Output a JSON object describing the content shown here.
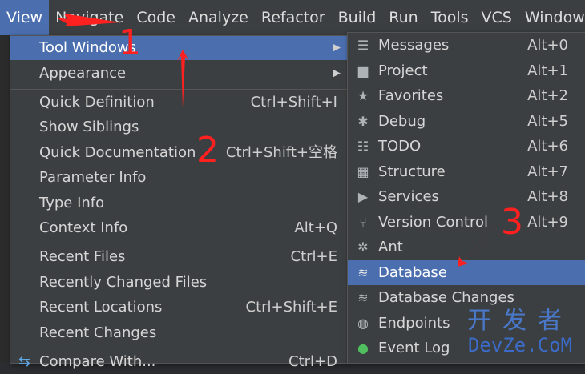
{
  "menubar": {
    "items": [
      "View",
      "Navigate",
      "Code",
      "Analyze",
      "Refactor",
      "Build",
      "Run",
      "Tools",
      "VCS",
      "Window"
    ]
  },
  "view_menu": {
    "items": [
      {
        "label": "Tool Windows",
        "shortcut": "",
        "submenu": true,
        "selected": true
      },
      {
        "label": "Appearance",
        "shortcut": "",
        "submenu": true
      },
      {
        "label": "Quick Definition",
        "shortcut": "Ctrl+Shift+I"
      },
      {
        "label": "Show Siblings",
        "shortcut": ""
      },
      {
        "label": "Quick Documentation",
        "shortcut": "Ctrl+Shift+空格"
      },
      {
        "label": "Parameter Info",
        "shortcut": ""
      },
      {
        "label": "Type Info",
        "shortcut": ""
      },
      {
        "label": "Context Info",
        "shortcut": "Alt+Q"
      },
      {
        "label": "Recent Files",
        "shortcut": "Ctrl+E"
      },
      {
        "label": "Recently Changed Files",
        "shortcut": ""
      },
      {
        "label": "Recent Locations",
        "shortcut": "Ctrl+Shift+E"
      },
      {
        "label": "Recent Changes",
        "shortcut": ""
      },
      {
        "label": "Compare With...",
        "shortcut": "Ctrl+D"
      }
    ]
  },
  "tool_windows": {
    "items": [
      {
        "label": "Messages",
        "shortcut": "Alt+0",
        "icon": "messages-icon"
      },
      {
        "label": "Project",
        "shortcut": "Alt+1",
        "icon": "folder-icon"
      },
      {
        "label": "Favorites",
        "shortcut": "Alt+2",
        "icon": "star-icon"
      },
      {
        "label": "Debug",
        "shortcut": "Alt+5",
        "icon": "bug-icon"
      },
      {
        "label": "TODO",
        "shortcut": "Alt+6",
        "icon": "todo-icon"
      },
      {
        "label": "Structure",
        "shortcut": "Alt+7",
        "icon": "structure-icon"
      },
      {
        "label": "Services",
        "shortcut": "Alt+8",
        "icon": "play-icon"
      },
      {
        "label": "Version Control",
        "shortcut": "Alt+9",
        "icon": "branch-icon"
      },
      {
        "label": "Ant",
        "shortcut": "",
        "icon": "ant-icon"
      },
      {
        "label": "Database",
        "shortcut": "",
        "icon": "database-icon",
        "selected": true
      },
      {
        "label": "Database Changes",
        "shortcut": "",
        "icon": "database-icon"
      },
      {
        "label": "Endpoints",
        "shortcut": "",
        "icon": "globe-icon"
      },
      {
        "label": "Event Log",
        "shortcut": "",
        "icon": "event-log-icon"
      }
    ]
  },
  "annotations": {
    "one": "1",
    "two": "2",
    "three": "3"
  },
  "watermark": {
    "cn": "开发者",
    "en": "DevZe.CoM"
  },
  "colors": {
    "selection": "#4b6eaf",
    "menu_bg": "#3c3f41",
    "annotation": "#ff2020"
  }
}
